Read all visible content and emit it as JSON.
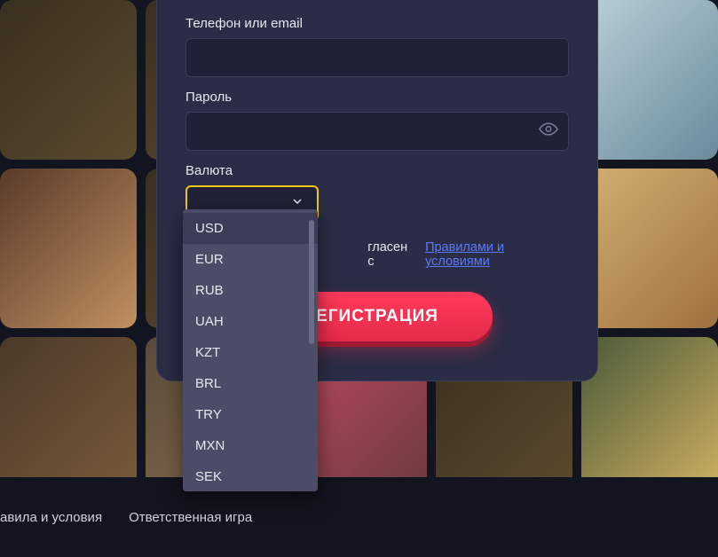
{
  "form": {
    "login_label": "Телефон или email",
    "login_value": "",
    "password_label": "Пароль",
    "password_value": "",
    "currency_label": "Валюта",
    "currency_selected": "",
    "terms_prefix": "гласен с ",
    "terms_link": "Правилами и условиями",
    "register_button": "ЕГИСТРАЦИЯ"
  },
  "currency_options": [
    "USD",
    "EUR",
    "RUB",
    "UAH",
    "KZT",
    "BRL",
    "TRY",
    "MXN",
    "SEK"
  ],
  "currency_selected_index": 0,
  "footer": {
    "terms": "авила и условия",
    "responsible": "Ответственная игра"
  }
}
